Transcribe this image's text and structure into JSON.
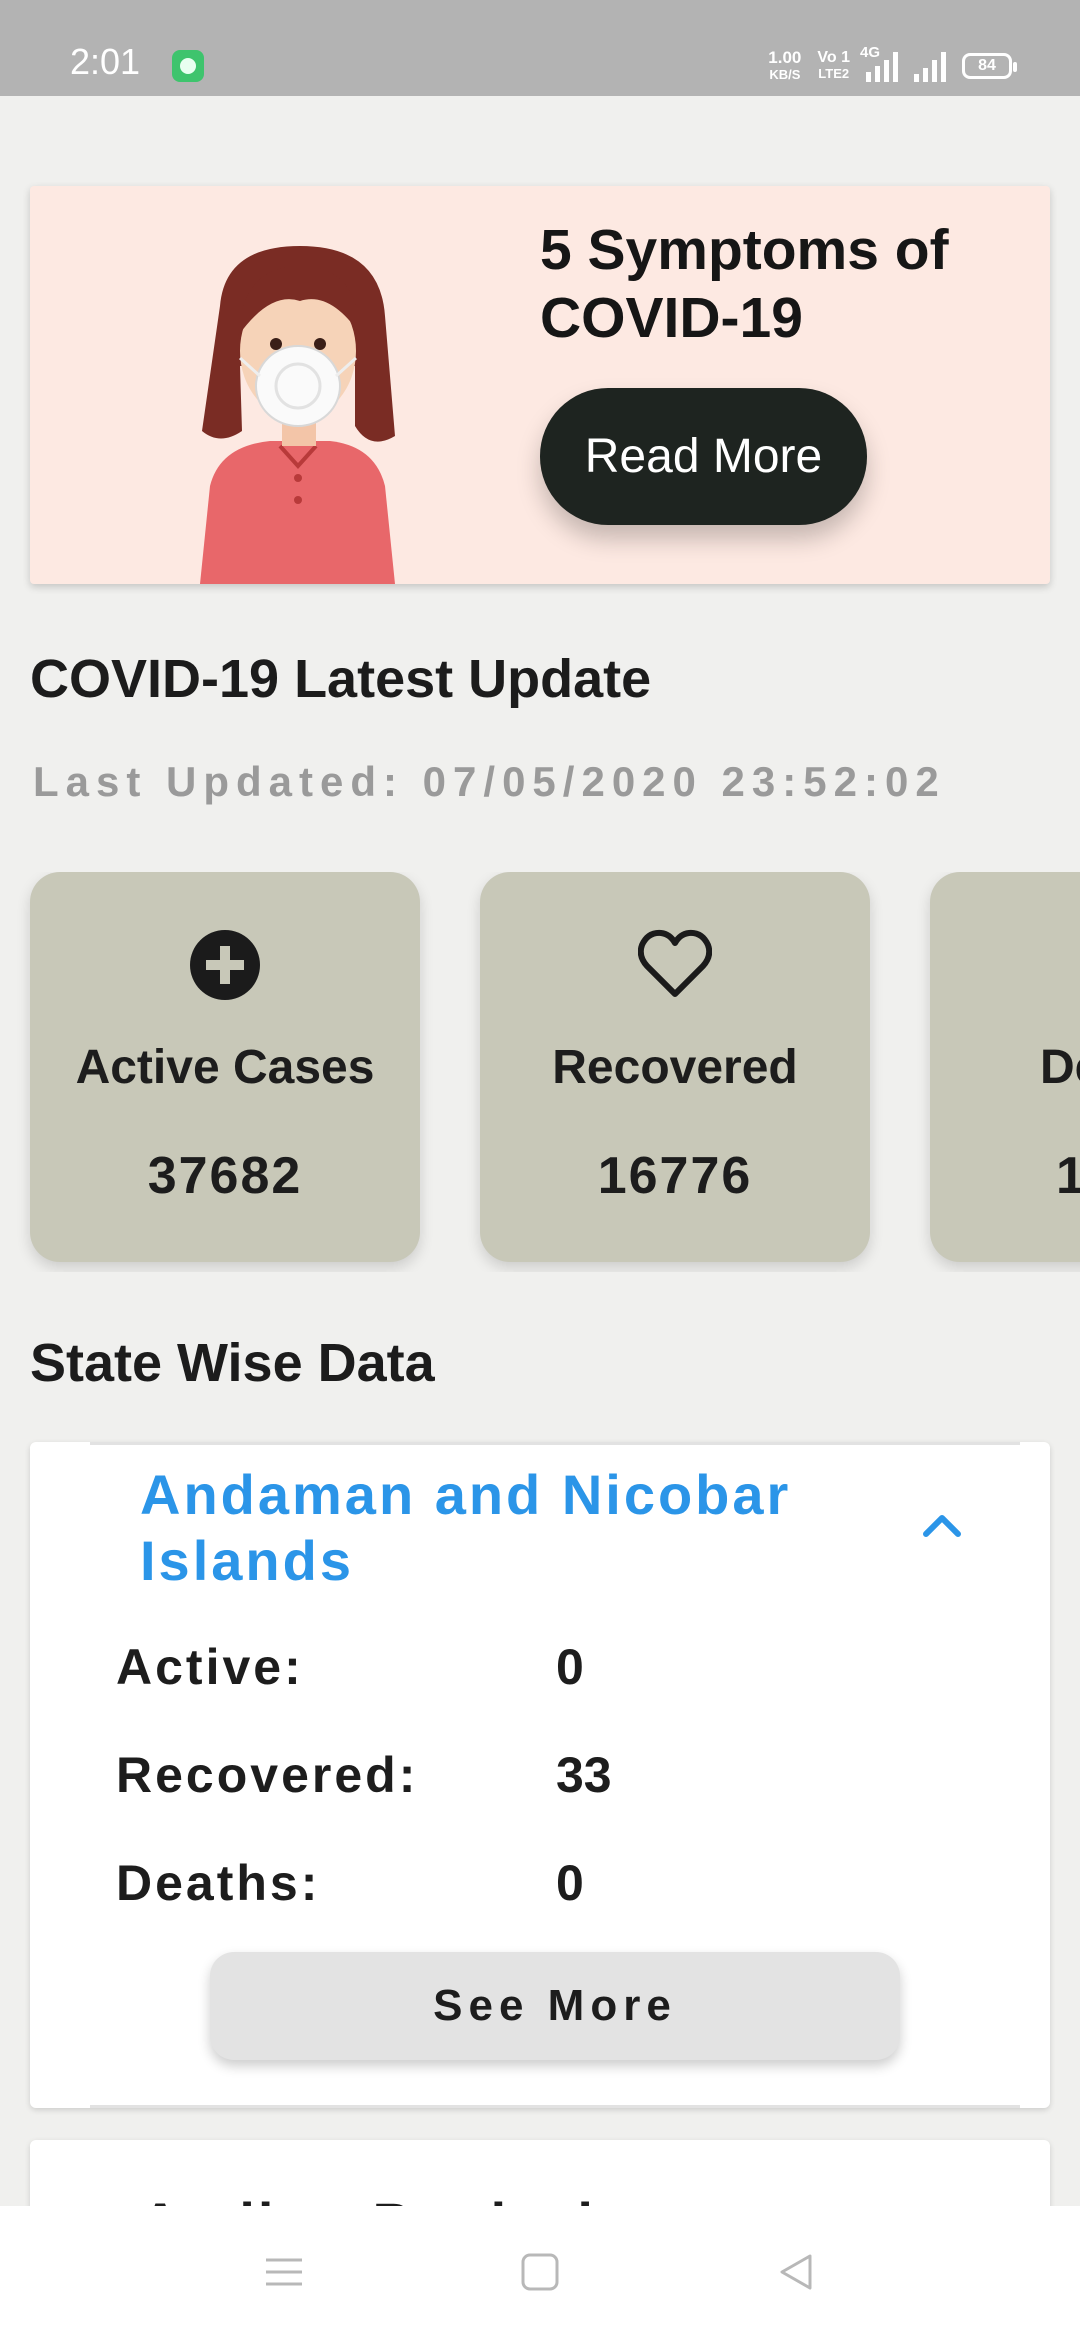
{
  "status_bar": {
    "time": "2:01",
    "net_speed_value": "1.00",
    "net_speed_unit": "KB/S",
    "volte_top": "Vo 1",
    "volte_bottom": "LTE2",
    "network_type": "4G",
    "battery": "84",
    "icons": [
      "chat-app-icon",
      "signal-icon",
      "signal-icon",
      "battery-icon"
    ]
  },
  "banner": {
    "title": "5 Symptoms of COVID-19",
    "button_label": "Read More",
    "illustration": "woman-wearing-mask-illustration"
  },
  "update": {
    "heading": "COVID-19 Latest Update",
    "last_updated": "Last Updated: 07/05/2020 23:52:02"
  },
  "stats": [
    {
      "icon": "plus-circle-icon",
      "label": "Active Cases",
      "value": "37682"
    },
    {
      "icon": "heart-outline-icon",
      "label": "Recovered",
      "value": "16776"
    },
    {
      "icon": "unknown-icon",
      "label": "De",
      "value": "1"
    }
  ],
  "state_wise": {
    "heading": "State Wise Data",
    "states": [
      {
        "name": "Andaman and Nicobar Islands",
        "rows": [
          {
            "label": "Active:",
            "value": "0"
          },
          {
            "label": "Recovered:",
            "value": "33"
          },
          {
            "label": "Deaths:",
            "value": "0"
          }
        ],
        "button_label": "See More"
      },
      {
        "name": "Andhra Pradesh"
      }
    ]
  },
  "colors": {
    "status_bar": "#b3b3b3",
    "banner_bg": "#fde9e2",
    "button_dark": "#1e2420",
    "stat_card": "#c8c8b8",
    "accent_blue": "#2b95e8",
    "page_bg": "#f0f0ee"
  },
  "nav_bar": {
    "icons": [
      "menu-icon",
      "home-square-icon",
      "back-triangle-icon"
    ]
  }
}
